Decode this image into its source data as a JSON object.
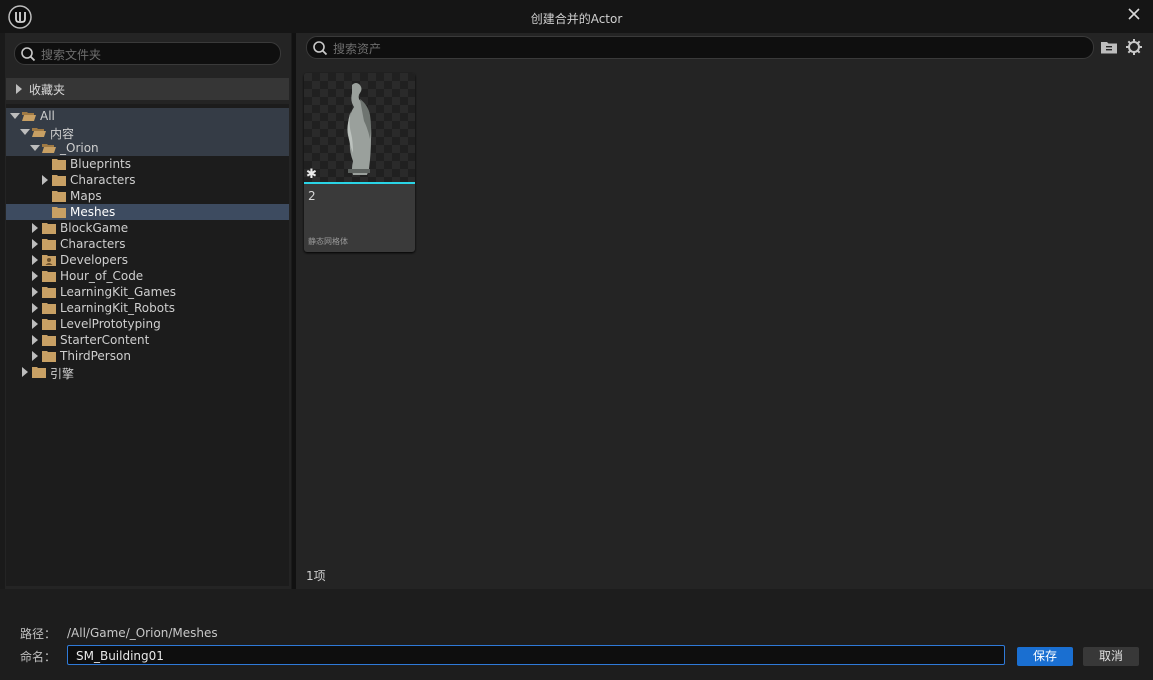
{
  "window": {
    "title": "创建合并的Actor"
  },
  "left": {
    "search_placeholder": "搜索文件夹",
    "favorites_label": "收藏夹",
    "tree": [
      {
        "label": "All"
      },
      {
        "label": "内容"
      },
      {
        "label": "_Orion"
      },
      {
        "label": "Blueprints"
      },
      {
        "label": "Characters"
      },
      {
        "label": "Maps"
      },
      {
        "label": "Meshes"
      },
      {
        "label": "BlockGame"
      },
      {
        "label": "Characters"
      },
      {
        "label": "Developers"
      },
      {
        "label": "Hour_of_Code"
      },
      {
        "label": "LearningKit_Games"
      },
      {
        "label": "LearningKit_Robots"
      },
      {
        "label": "LevelPrototyping"
      },
      {
        "label": "StarterContent"
      },
      {
        "label": "ThirdPerson"
      },
      {
        "label": "引擎"
      }
    ]
  },
  "right": {
    "search_placeholder": "搜索资产",
    "assets": [
      {
        "name": "2",
        "type": "静态网格体"
      }
    ],
    "item_count": "1项"
  },
  "footer": {
    "path_label": "路径：",
    "path_value": "/All/Game/_Orion/Meshes",
    "name_label": "命名：",
    "name_value": "SM_Building01",
    "save_label": "保存",
    "cancel_label": "取消"
  },
  "colors": {
    "accent": "#1a6fd1",
    "selection": "#3d4b60",
    "folder": "#c8a064",
    "thumb_bar": "#2ad4e6"
  }
}
